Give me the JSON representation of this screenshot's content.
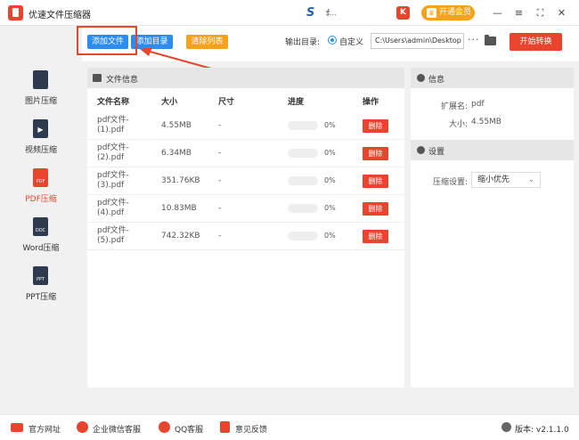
{
  "app": {
    "title": "优速文件压缩器",
    "vip_label": "开通会员",
    "k_icon": "K",
    "min": "—",
    "menu": "≡",
    "max": "⛶",
    "close": "✕",
    "brand_mark": "S",
    "brand_text": "ई..."
  },
  "sidebar": {
    "items": [
      {
        "label": "图片压缩",
        "icon_text": "",
        "active": false
      },
      {
        "label": "视频压缩",
        "icon_text": "▶",
        "active": false
      },
      {
        "label": "PDF压缩",
        "icon_text": "PDF",
        "active": true
      },
      {
        "label": "Word压缩",
        "icon_text": "DOC",
        "active": false
      },
      {
        "label": "PPT压缩",
        "icon_text": "PPT",
        "active": false
      }
    ]
  },
  "toolbar": {
    "add_file": "添加文件",
    "add_dir": "添加目录",
    "clear_list": "清除列表",
    "output_dir_label": "输出目录:",
    "custom_label": "自定义",
    "output_path": "C:\\Users\\admin\\Desktop",
    "more": "···",
    "start": "开始转换"
  },
  "file_panel": {
    "title": "文件信息",
    "columns": [
      "文件名称",
      "大小",
      "尺寸",
      "进度",
      "操作"
    ],
    "rows": [
      {
        "name_1": "pdf文件-",
        "name_2": "(1).pdf",
        "size": "4.55MB",
        "dim": "-",
        "progress": 0,
        "pct": "0%",
        "action": "删除"
      },
      {
        "name_1": "pdf文件-",
        "name_2": "(2).pdf",
        "size": "6.34MB",
        "dim": "-",
        "progress": 0,
        "pct": "0%",
        "action": "删除"
      },
      {
        "name_1": "pdf文件-",
        "name_2": "(3).pdf",
        "size": "351.76KB",
        "dim": "-",
        "progress": 0,
        "pct": "0%",
        "action": "删除"
      },
      {
        "name_1": "pdf文件-",
        "name_2": "(4).pdf",
        "size": "10.83MB",
        "dim": "-",
        "progress": 0,
        "pct": "0%",
        "action": "删除"
      },
      {
        "name_1": "pdf文件-",
        "name_2": "(5).pdf",
        "size": "742.32KB",
        "dim": "-",
        "progress": 0,
        "pct": "0%",
        "action": "删除"
      }
    ]
  },
  "info_panel": {
    "title": "信息",
    "ext_key": "扩展名:",
    "ext_val": "pdf",
    "size_key": "大小:",
    "size_val": "4.55MB",
    "settings_title": "设置",
    "compress_key": "压缩设置:",
    "compress_val": "缩小优先",
    "chevron": "⌄"
  },
  "footer": {
    "website": "官方网址",
    "wechat": "企业微信客服",
    "qq": "QQ客服",
    "feedback": "意见反馈",
    "version": "版本: v2.1.1.0"
  },
  "colors": {
    "accent_red": "#e8442e",
    "accent_blue": "#2d8cf0",
    "accent_orange": "#f7a21b"
  }
}
